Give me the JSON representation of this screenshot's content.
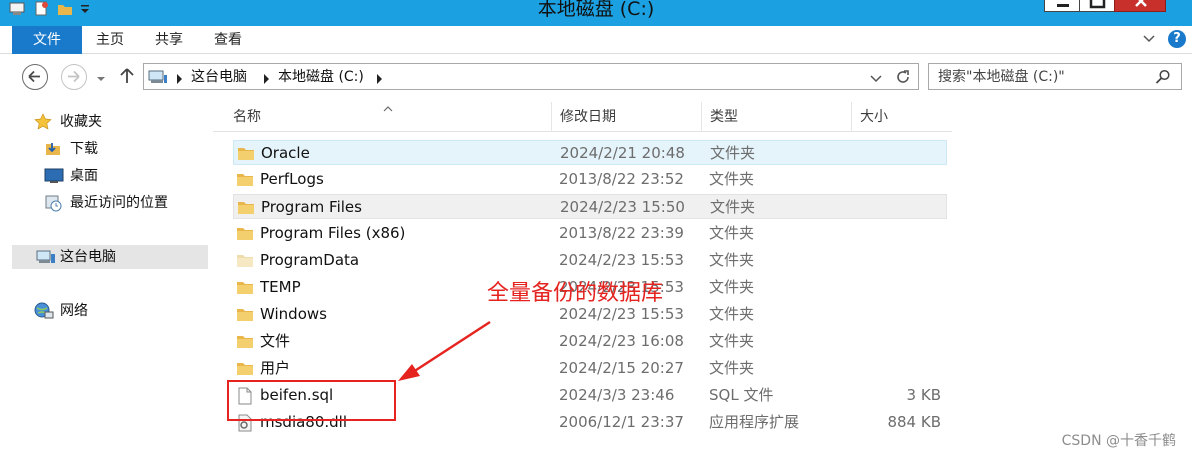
{
  "window": {
    "title": "本地磁盘 (C:)"
  },
  "ribbon": {
    "tabs": [
      {
        "label": "文件",
        "active": true
      },
      {
        "label": "主页"
      },
      {
        "label": "共享"
      },
      {
        "label": "查看"
      }
    ],
    "help_label": "?"
  },
  "address": {
    "crumbs": [
      "这台电脑",
      "本地磁盘 (C:)"
    ]
  },
  "search": {
    "placeholder": "搜索\"本地磁盘 (C:)\""
  },
  "nav": {
    "items": [
      {
        "label": "收藏夹",
        "icon": "star-icon"
      },
      {
        "label": "下载",
        "icon": "downloads-folder-icon"
      },
      {
        "label": "桌面",
        "icon": "desktop-icon"
      },
      {
        "label": "最近访问的位置",
        "icon": "recent-places-icon"
      },
      {
        "label": "这台电脑",
        "icon": "computer-icon",
        "selected": true
      },
      {
        "label": "网络",
        "icon": "network-icon"
      }
    ]
  },
  "columns": [
    "名称",
    "修改日期",
    "类型",
    "大小"
  ],
  "files": [
    {
      "name": "Oracle",
      "date": "2024/2/21 20:48",
      "type": "文件夹",
      "size": "",
      "icon": "folder-icon",
      "state": "hover"
    },
    {
      "name": "PerfLogs",
      "date": "2013/8/22 23:52",
      "type": "文件夹",
      "size": "",
      "icon": "folder-icon"
    },
    {
      "name": "Program Files",
      "date": "2024/2/23 15:50",
      "type": "文件夹",
      "size": "",
      "icon": "folder-icon",
      "state": "selected"
    },
    {
      "name": "Program Files (x86)",
      "date": "2013/8/22 23:39",
      "type": "文件夹",
      "size": "",
      "icon": "folder-icon"
    },
    {
      "name": "ProgramData",
      "date": "2024/2/23 15:53",
      "type": "文件夹",
      "size": "",
      "icon": "folder-hidden-icon"
    },
    {
      "name": "TEMP",
      "date": "2024/2/23 15:53",
      "type": "文件夹",
      "size": "",
      "icon": "folder-icon"
    },
    {
      "name": "Windows",
      "date": "2024/2/23 15:53",
      "type": "文件夹",
      "size": "",
      "icon": "folder-icon"
    },
    {
      "name": "文件",
      "date": "2024/2/23 16:08",
      "type": "文件夹",
      "size": "",
      "icon": "folder-icon"
    },
    {
      "name": "用户",
      "date": "2024/2/15 20:27",
      "type": "文件夹",
      "size": "",
      "icon": "folder-icon"
    },
    {
      "name": "beifen.sql",
      "date": "2024/3/3 23:46",
      "type": "SQL 文件",
      "size": "3 KB",
      "icon": "document-icon"
    },
    {
      "name": "msdia80.dll",
      "date": "2006/12/1 23:37",
      "type": "应用程序扩展",
      "size": "884 KB",
      "icon": "dll-file-icon"
    }
  ],
  "annotation": {
    "text": "全量备份的数据库",
    "color": "#e52420"
  },
  "watermark": "CSDN @十香千鹤",
  "colors": {
    "titlebar": "#1ba1e2",
    "file_tab": "#1979ca",
    "hover_row": "#e5f3fb",
    "folder": "#e8b64a"
  }
}
